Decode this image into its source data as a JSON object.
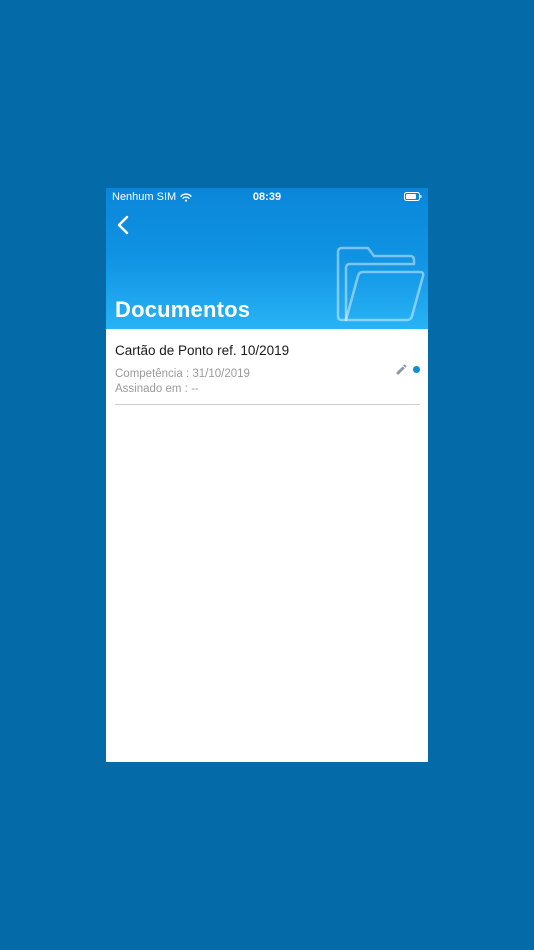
{
  "status_bar": {
    "carrier": "Nenhum SIM",
    "time": "08:39",
    "wifi_icon": "wifi-icon",
    "battery_icon": "battery-icon"
  },
  "header": {
    "back_icon": "chevron-left-icon",
    "title": "Documentos",
    "decoration_icon": "folder-icon",
    "gradient_top": "#0a86d8",
    "gradient_bottom": "#28b3f5"
  },
  "documents": [
    {
      "title": "Cartão de Ponto ref. 10/2019",
      "competencia": "Competência : 31/10/2019",
      "assinado": "Assinado em :  --",
      "action_icon": "pencil-icon",
      "status_color": "#0a8ee0"
    }
  ],
  "colors": {
    "background": "#056aa8",
    "surface": "#ffffff",
    "accent": "#0a8ee0"
  }
}
